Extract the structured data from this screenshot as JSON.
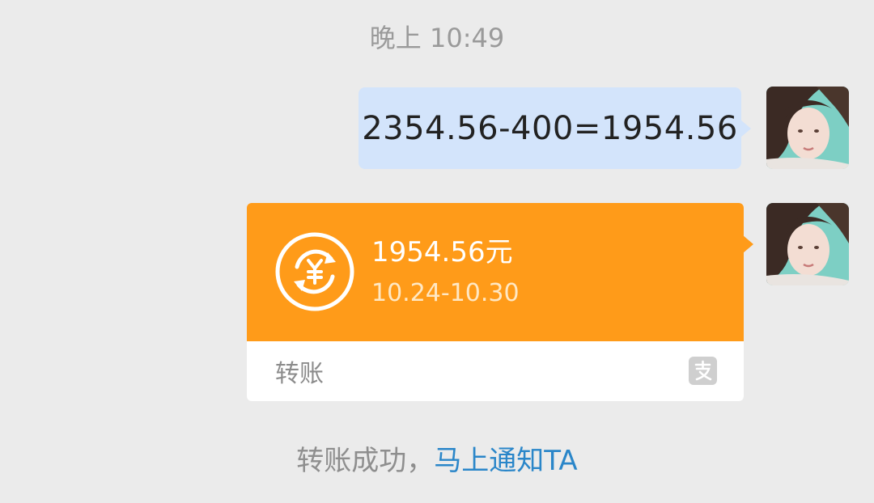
{
  "timestamp": "晚上 10:49",
  "message": {
    "text": "2354.56-400=1954.56"
  },
  "transfer": {
    "amount": "1954.56元",
    "date_range": "10.24-10.30",
    "label": "转账",
    "icon": "currency-exchange-icon",
    "provider_icon": "alipay-icon"
  },
  "notice": {
    "prefix": "转账成功，",
    "link": "马上通知TA"
  },
  "colors": {
    "bubble_bg": "#d3e4fb",
    "transfer_orange": "#ff9b19",
    "link_blue": "#2a86c9",
    "page_bg": "#ebebeb"
  }
}
